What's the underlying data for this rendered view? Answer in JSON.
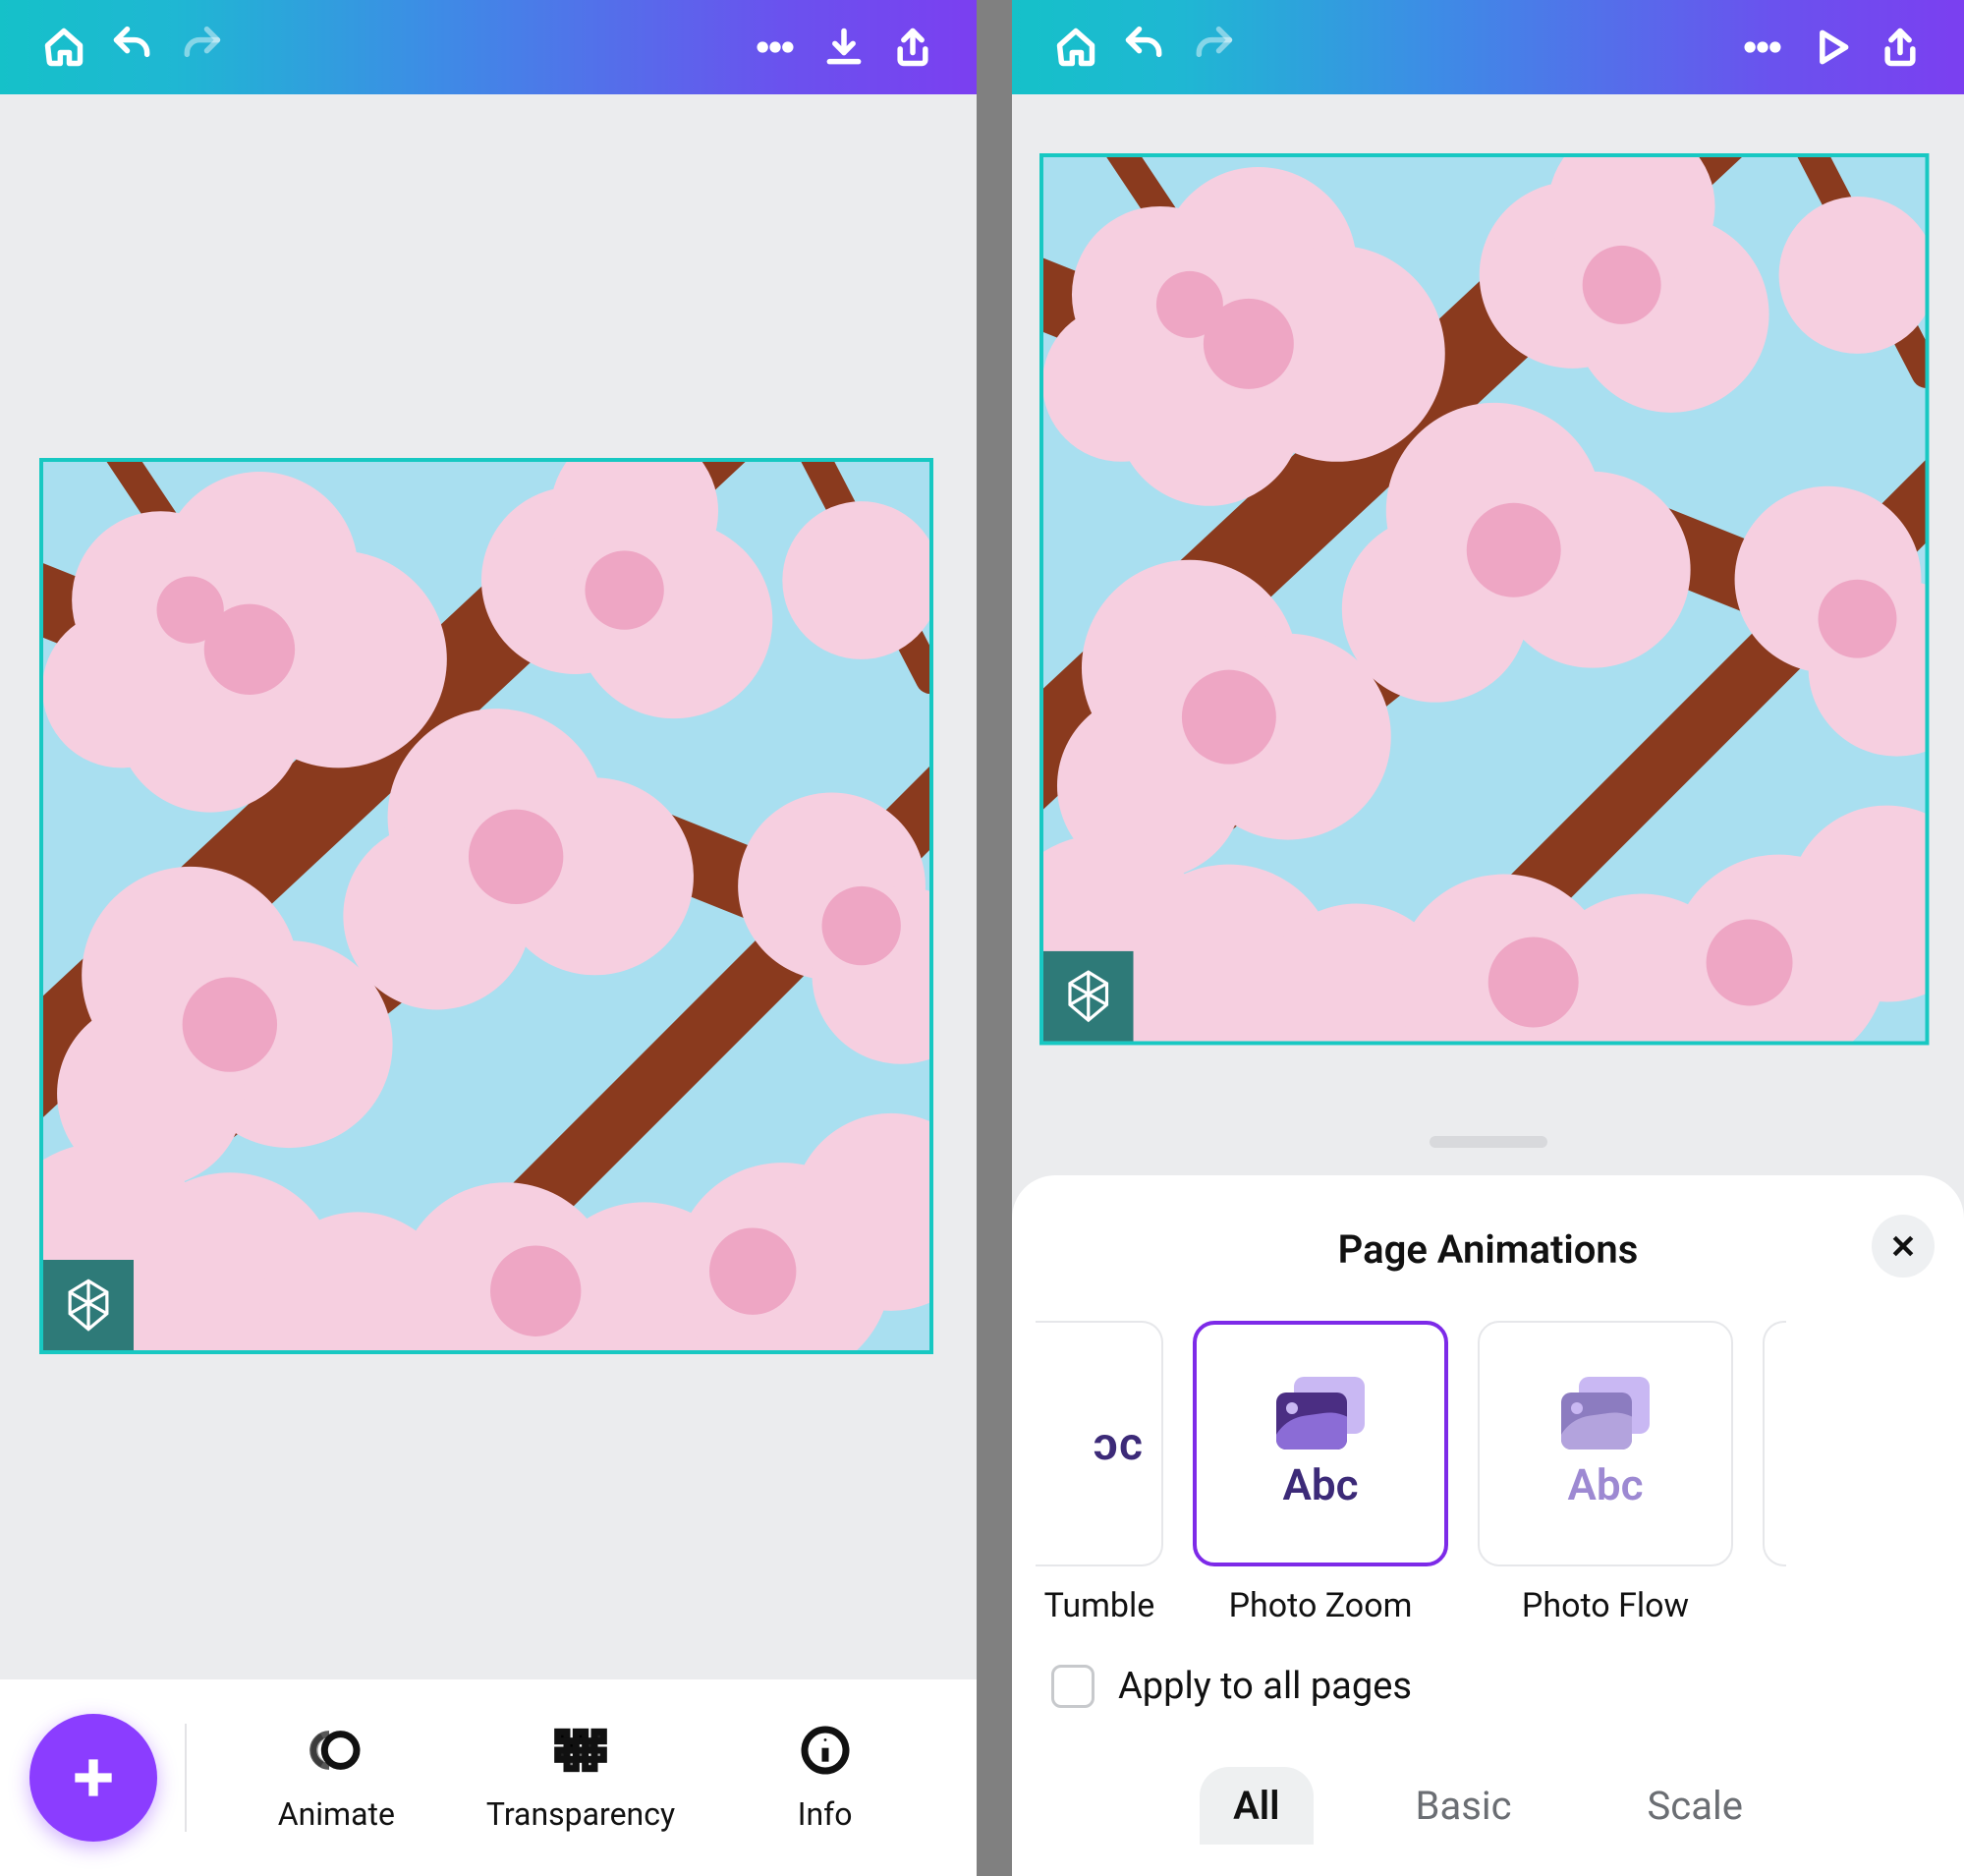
{
  "left": {
    "tools": {
      "animate": "Animate",
      "transparency": "Transparency",
      "info": "Info"
    }
  },
  "right": {
    "sheet_title": "Page Animations",
    "animations": {
      "tumble": "Tumble",
      "photo_zoom": "Photo Zoom",
      "photo_flow": "Photo Flow",
      "abc_glyph": "Abc",
      "tumble_glyph": "ɔc"
    },
    "apply_all": "Apply to all pages",
    "tabs": {
      "all": "All",
      "basic": "Basic",
      "scale": "Scale"
    }
  }
}
